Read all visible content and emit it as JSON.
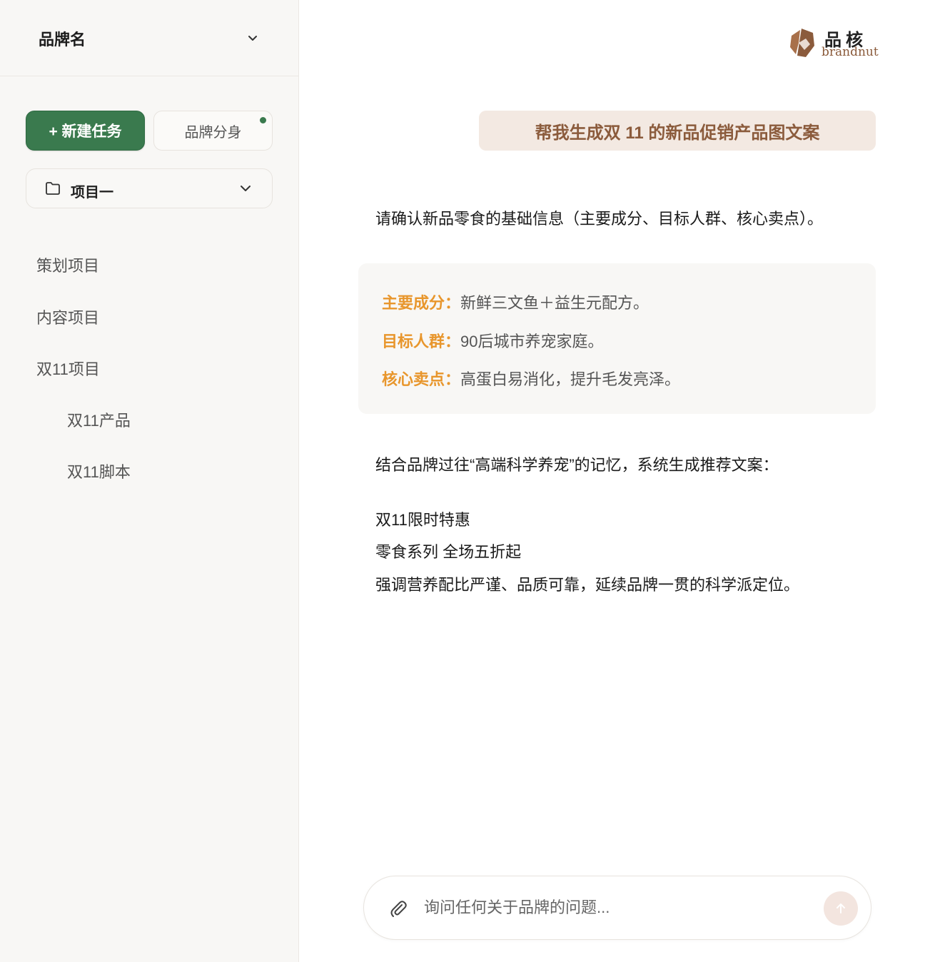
{
  "sidebar": {
    "brand_name": "品牌名",
    "new_task_label": "+ 新建任务",
    "avatar_label": "品牌分身",
    "project_select": "项目一",
    "nav": [
      {
        "label": "策划项目"
      },
      {
        "label": "内容项目"
      },
      {
        "label": "双11项目"
      },
      {
        "label": "双11产品"
      },
      {
        "label": "双11脚本"
      }
    ]
  },
  "logo": {
    "cn": "品核",
    "en": "brandnut"
  },
  "chat": {
    "user_message": "帮我生成双 11 的新品促销产品图文案",
    "reply_intro": "请确认新品零食的基础信息（主要成分、目标人群、核心卖点）。",
    "info": [
      {
        "key": "主要成分：",
        "value": "新鲜三文鱼＋益生元配方。"
      },
      {
        "key": "目标人群：",
        "value": "90后城市养宠家庭。"
      },
      {
        "key": "核心卖点：",
        "value": "高蛋白易消化，提升毛发亮泽。"
      }
    ],
    "reply_memory": "结合品牌过往“高端科学养宠”的记忆，系统生成推荐文案：",
    "copy_lines": [
      "双11限时特惠",
      "零食系列 全场五折起",
      "强调营养配比严谨、品质可靠，延续品牌一贯的科学派定位。"
    ]
  },
  "input": {
    "placeholder": "询问任何关于品牌的问题..."
  },
  "colors": {
    "primary_green": "#3a7a4e",
    "accent_orange": "#e8962c",
    "brand_brown": "#8b5b3c"
  }
}
